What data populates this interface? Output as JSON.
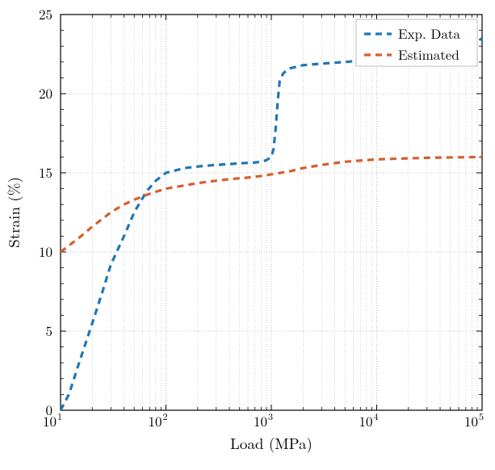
{
  "chart_data": {
    "type": "line",
    "title": "",
    "xlabel": "Load (MPa)",
    "ylabel": "Strain (%)",
    "xscale": "log",
    "xlim": [
      10,
      100000
    ],
    "ylim": [
      0,
      25
    ],
    "xticks_major": [
      10,
      100,
      1000,
      10000,
      100000
    ],
    "xtick_labels_major": [
      "10^{1}",
      "10^{2}",
      "10^{3}",
      "10^{4}",
      "10^{5}"
    ],
    "yticks_major": [
      0,
      5,
      10,
      15,
      20,
      25
    ],
    "legend": {
      "position": "upper-right",
      "entries": [
        {
          "name": "Exp. Data",
          "color": "#1f77b4",
          "dash": "8,6"
        },
        {
          "name": "Estimated",
          "color": "#d65f2c",
          "dash": "8,6"
        }
      ]
    },
    "series": [
      {
        "name": "Exp. Data",
        "color": "#1f77b4",
        "dash": "8,6",
        "x": [
          10,
          12,
          15,
          20,
          25,
          30,
          40,
          50,
          65,
          80,
          100,
          150,
          200,
          300,
          400,
          500,
          700,
          800,
          900,
          1000,
          1050,
          1100,
          1150,
          1200,
          1300,
          1500,
          2000,
          3000,
          5000,
          10000,
          30000,
          60000,
          90000,
          100000
        ],
        "y": [
          0.0,
          1.0,
          3.0,
          5.5,
          7.5,
          9.2,
          11.0,
          12.5,
          13.8,
          14.5,
          15.0,
          15.3,
          15.4,
          15.5,
          15.55,
          15.6,
          15.65,
          15.7,
          15.8,
          16.0,
          16.5,
          17.8,
          19.5,
          20.8,
          21.3,
          21.6,
          21.8,
          21.9,
          22.0,
          22.2,
          22.6,
          23.0,
          23.3,
          23.5
        ],
        "interactable": false
      },
      {
        "name": "Estimated",
        "color": "#d65f2c",
        "dash": "8,6",
        "x": [
          10,
          12,
          15,
          20,
          25,
          30,
          40,
          50,
          65,
          80,
          100,
          150,
          200,
          300,
          400,
          600,
          800,
          1000,
          1500,
          2000,
          3000,
          5000,
          10000,
          30000,
          100000
        ],
        "y": [
          10.0,
          10.4,
          10.9,
          11.6,
          12.1,
          12.5,
          13.0,
          13.3,
          13.6,
          13.8,
          14.0,
          14.2,
          14.35,
          14.5,
          14.6,
          14.7,
          14.8,
          14.9,
          15.1,
          15.3,
          15.5,
          15.7,
          15.85,
          15.95,
          16.0
        ],
        "interactable": false
      }
    ]
  }
}
